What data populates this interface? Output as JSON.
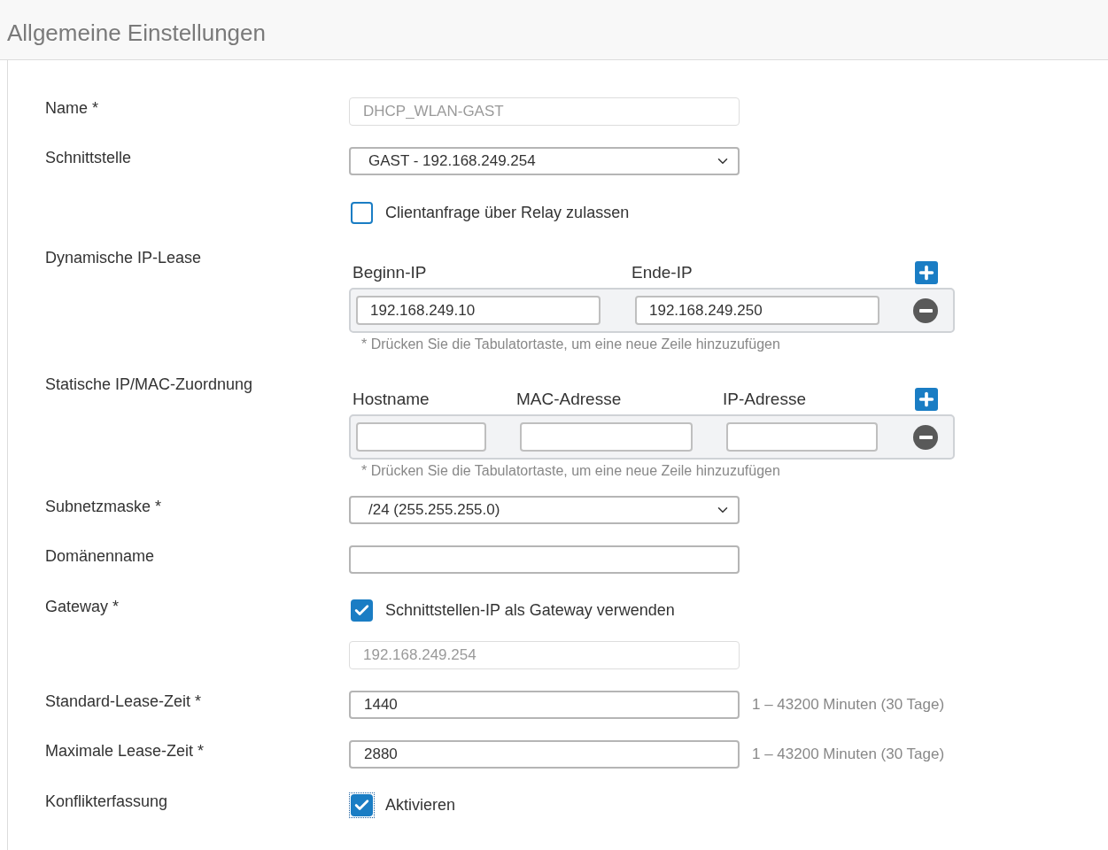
{
  "section_title": "Allgemeine Einstellungen",
  "rows": [
    {
      "kind": "input",
      "label": "Name *",
      "value": "DHCP_WLAN-GAST",
      "disabled": true
    },
    {
      "kind": "select",
      "label": "Schnittstelle",
      "value": "GAST - 192.168.249.254"
    },
    {
      "kind": "checkbox",
      "text": "Clientanfrage über Relay zulassen",
      "checked": false,
      "focused": false
    },
    {
      "kind": "table",
      "label": "Dynamische IP-Lease",
      "columns": [
        "Beginn-IP",
        "Ende-IP"
      ],
      "rows": [
        {
          "kind": "filled",
          "values": [
            "192.168.249.10",
            "192.168.249.250"
          ]
        }
      ],
      "hint": "* Drücken Sie die Tabulatortaste, um eine neue Zeile hinzuzufügen"
    },
    {
      "kind": "table",
      "label": "Statische IP/MAC-Zuordnung",
      "columns": [
        "Hostname",
        "MAC-Adresse",
        "IP-Adresse"
      ],
      "rows": [
        {
          "kind": "blank"
        }
      ],
      "hint": "* Drücken Sie die Tabulatortaste, um eine neue Zeile hinzuzufügen"
    },
    {
      "kind": "select",
      "label": "Subnetzmaske *",
      "value": "/24 (255.255.255.0)"
    },
    {
      "kind": "input",
      "label": "Domänenname",
      "value": null,
      "disabled": false
    },
    {
      "kind": "checkbox",
      "label": "Gateway *",
      "text": "Schnittstellen-IP als Gateway verwenden",
      "checked": true,
      "focused": false
    },
    {
      "kind": "input",
      "value": "192.168.249.254",
      "disabled": true
    },
    {
      "kind": "input",
      "label": "Standard-Lease-Zeit *",
      "value": "1440",
      "disabled": false,
      "suffix": "1 – 43200 Minuten (30 Tage)"
    },
    {
      "kind": "input",
      "label": "Maximale Lease-Zeit *",
      "value": "2880",
      "disabled": false,
      "suffix": "1 – 43200 Minuten (30 Tage)"
    },
    {
      "kind": "checkbox",
      "label": "Konflikterfassung",
      "text": "Aktivieren",
      "checked": true,
      "focused": true
    }
  ]
}
